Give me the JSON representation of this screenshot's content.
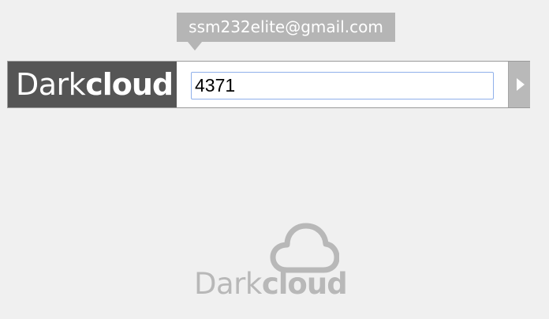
{
  "tooltip": {
    "text": "ssm232elite@gmail.com"
  },
  "brand": {
    "part1": "Dark",
    "part2": "cloud"
  },
  "pin_field": {
    "value": "4371"
  },
  "submit": {
    "icon": "arrow-right-icon"
  },
  "footer_logo": {
    "icon": "cloud-icon",
    "part1": "Dark",
    "part2": "cloud"
  },
  "colors": {
    "background": "#f0f0f0",
    "brand_bg": "#555555",
    "tooltip_bg": "#b5b5b5",
    "input_border": "#8fb0ea",
    "footer_logo": "#b8b8b8"
  }
}
